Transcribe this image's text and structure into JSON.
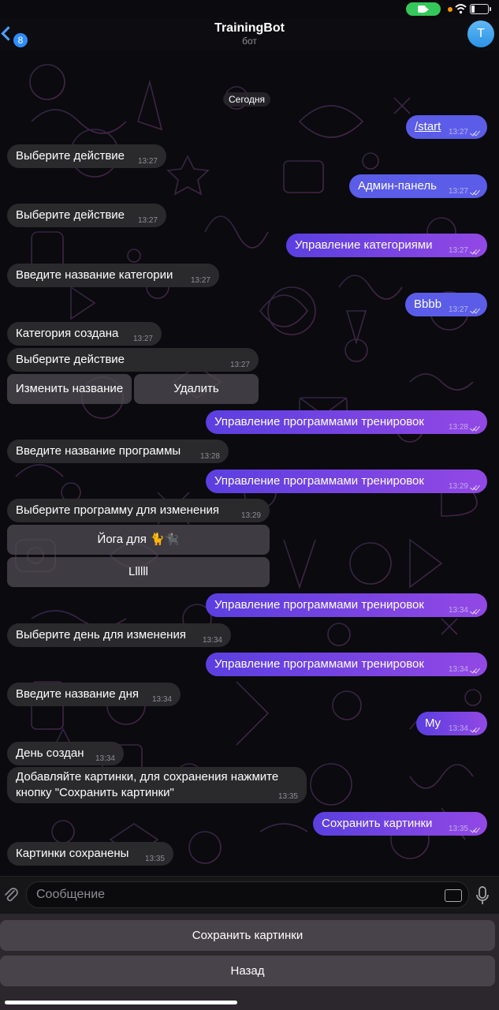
{
  "header": {
    "back_count": "8",
    "title": "TrainingBot",
    "subtitle": "бот",
    "avatar_letter": "T"
  },
  "date_label": "Сегодня",
  "messages": [
    {
      "text": "/start",
      "time": "13:27"
    },
    {
      "text": "Выберите действие",
      "time": "13:27"
    },
    {
      "text": "Админ-панель",
      "time": "13:27"
    },
    {
      "text": "Выберите действие",
      "time": "13:27"
    },
    {
      "text": "Управление категориями",
      "time": "13:27"
    },
    {
      "text": "Введите название категории",
      "time": "13:27"
    },
    {
      "text": "Bbbb",
      "time": "13:27"
    },
    {
      "text": "Категория создана",
      "time": "13:27"
    },
    {
      "text": "Выберите действие",
      "time": "13:27"
    },
    {
      "text": "Управление программами тренировок",
      "time": "13:28"
    },
    {
      "text": "Введите название программы",
      "time": "13:28"
    },
    {
      "text": "Управление программами тренировок",
      "time": "13:29"
    },
    {
      "text": "Выберите программу для изменения",
      "time": "13:29"
    },
    {
      "text": "Управление программами тренировок",
      "time": "13:34"
    },
    {
      "text": "Выберите день для изменения",
      "time": "13:34"
    },
    {
      "text": "Управление программами тренировок",
      "time": "13:34"
    },
    {
      "text": "Введите название дня",
      "time": "13:34"
    },
    {
      "text": "My",
      "time": "13:34"
    },
    {
      "text": "День создан",
      "time": "13:34"
    },
    {
      "text": "Добавляйте картинки, для сохранения нажмите",
      "text2": "кнопку \"Сохранить картинки\"",
      "time": "13:35"
    },
    {
      "text": "Сохранить картинки",
      "time": "13:35"
    },
    {
      "text": "Картинки сохранены",
      "time": "13:35"
    }
  ],
  "inline_buttons": {
    "rename": "Изменить название",
    "delete": "Удалить",
    "program1": "Йога для 🐈🐈‍⬛",
    "program2": "Llllll"
  },
  "input": {
    "placeholder": "Сообщение"
  },
  "reply_keyboard": {
    "save_images": "Сохранить картинки",
    "back": "Назад"
  },
  "colors": {
    "incoming": "#2a2a2d",
    "outgoing_start": "#5b3fe0",
    "outgoing_end": "#9248e4",
    "accent": "#2f8cff"
  },
  "icons": [
    "back-chevron-icon",
    "camera-icon",
    "wifi-icon",
    "battery-icon",
    "attach-icon",
    "keyboard-icon",
    "microphone-icon",
    "read-checkmarks-icon"
  ]
}
